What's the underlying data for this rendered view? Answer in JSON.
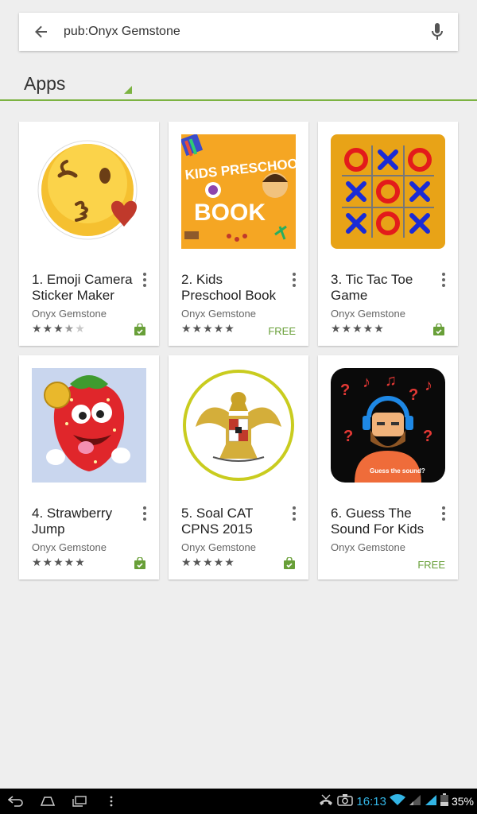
{
  "search": {
    "query": "pub:Onyx Gemstone",
    "back_icon": "arrow-back-icon",
    "mic_icon": "mic-icon"
  },
  "section": {
    "title": "Apps"
  },
  "apps": [
    {
      "title": "1. Emoji Camera Sticker Maker",
      "developer": "Onyx Gemstone",
      "rating": 3.5,
      "price": "",
      "installed": true
    },
    {
      "title": "2. Kids Preschool Book",
      "developer": "Onyx Gemstone",
      "rating": 5,
      "price": "FREE",
      "installed": false,
      "thumb_text_top": "KIDS PRESCHOOL",
      "thumb_text_bottom": "BOOK"
    },
    {
      "title": "3. Tic Tac Toe Game",
      "developer": "Onyx Gemstone",
      "rating": 5,
      "price": "",
      "installed": true
    },
    {
      "title": "4. Strawberry Jump",
      "developer": "Onyx Gemstone",
      "rating": 5,
      "price": "",
      "installed": true
    },
    {
      "title": "5. Soal CAT CPNS 2015",
      "developer": "Onyx Gemstone",
      "rating": 5,
      "price": "",
      "installed": true
    },
    {
      "title": "6. Guess The Sound For Kids",
      "developer": "Onyx Gemstone",
      "rating": null,
      "price": "FREE",
      "installed": false,
      "thumb_caption": "Guess the sound?"
    }
  ],
  "colors": {
    "accent_green": "#7cb342",
    "free_green": "#689f38",
    "status_blue": "#33b5e5"
  },
  "statusbar": {
    "time": "16:13",
    "battery": "35%"
  },
  "navbar": {
    "icons": [
      "back-icon",
      "home-icon",
      "recents-icon",
      "menu-icon"
    ]
  }
}
